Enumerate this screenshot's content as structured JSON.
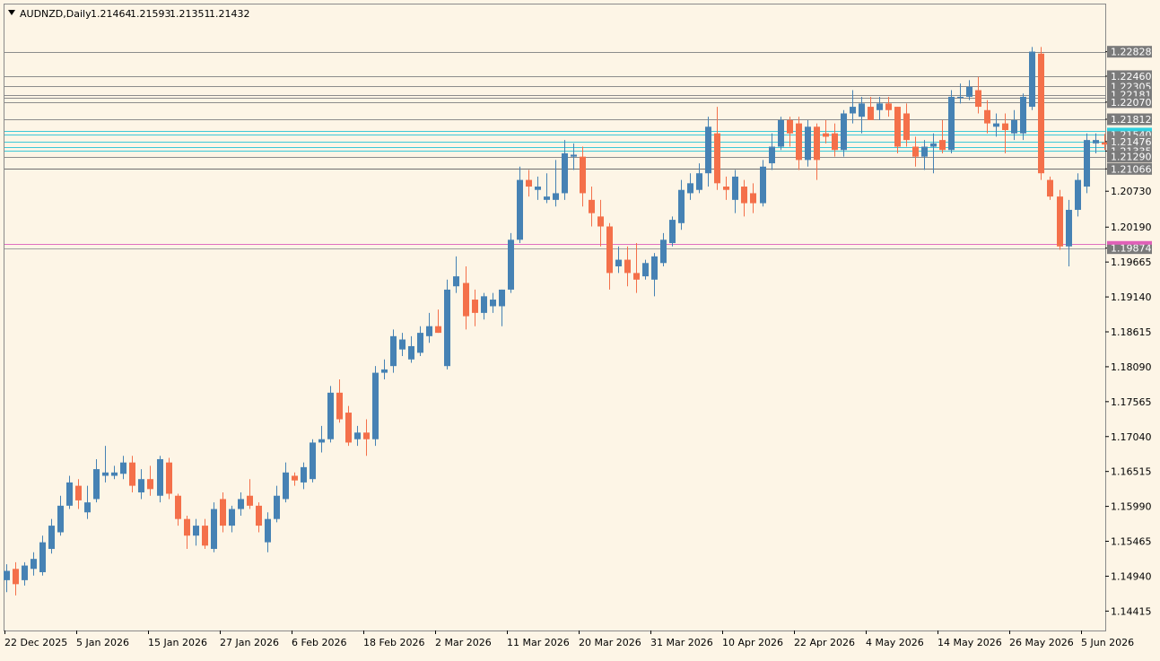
{
  "chart_data": {
    "type": "candlestick",
    "symbol_label": "AUDNZD,Daily",
    "header_ohlc": [
      "1.21464",
      "1.21593",
      "1.21351",
      "1.21432"
    ],
    "ylim": [
      1.1415,
      1.2308
    ],
    "y_ticks": [
      "1.22828",
      "1.22460",
      "1.22070",
      "1.21812",
      "1.21476",
      "1.21335",
      "1.21066",
      "1.20730",
      "1.20190",
      "1.19874",
      "1.19665",
      "1.19140",
      "1.18615",
      "1.18090",
      "1.17565",
      "1.17040",
      "1.16515",
      "1.15990",
      "1.15465",
      "1.14940",
      "1.14415"
    ],
    "x_ticks": [
      "22 Dec 2025",
      "5 Jan 2026",
      "15 Jan 2026",
      "27 Jan 2026",
      "6 Feb 2026",
      "18 Feb 2026",
      "2 Mar 2026",
      "11 Mar 2026",
      "20 Mar 2026",
      "31 Mar 2026",
      "10 Apr 2026",
      "22 Apr 2026",
      "4 May 2026",
      "14 May 2026",
      "26 May 2026",
      "5 Jun 2026"
    ],
    "levels": [
      {
        "value": 1.22828,
        "color": "#8c8c8c",
        "label": "1.22828"
      },
      {
        "value": 1.2246,
        "color": "#8c8c8c",
        "label": "1.22460"
      },
      {
        "value": 1.22305,
        "color": "#8c8c8c",
        "label": "1.22305"
      },
      {
        "value": 1.22181,
        "color": "#8c8c8c",
        "label": "1.22181"
      },
      {
        "value": 1.2214,
        "color": "#8c8c8c",
        "label": ""
      },
      {
        "value": 1.2207,
        "color": "#8c8c8c",
        "label": "1.22070"
      },
      {
        "value": 1.21812,
        "color": "#8c8c8c",
        "label": "1.21812"
      },
      {
        "value": 1.2164,
        "color": "#3cc8d8",
        "label": ""
      },
      {
        "value": 1.2158,
        "color": "#3cc8d8",
        "label": "1.21540"
      },
      {
        "value": 1.21476,
        "color": "#3cc8d8",
        "label": "1.21476"
      },
      {
        "value": 1.214,
        "color": "#3cc8d8",
        "label": ""
      },
      {
        "value": 1.21335,
        "color": "#3cc8d8",
        "label": "1.21335"
      },
      {
        "value": 1.2125,
        "color": "#8c8c8c",
        "label": "1.21290"
      },
      {
        "value": 1.21066,
        "color": "#6e6e6e",
        "label": "1.21066"
      },
      {
        "value": 1.1994,
        "color": "#e070c0",
        "label": ""
      },
      {
        "value": 1.19874,
        "color": "#a0a0a0",
        "label": "1.19874"
      }
    ],
    "current_price": 1.21658,
    "candles": [
      {
        "o": 1.1488,
        "h": 1.1512,
        "l": 1.147,
        "c": 1.1502
      },
      {
        "o": 1.1505,
        "h": 1.1515,
        "l": 1.1465,
        "c": 1.1482
      },
      {
        "o": 1.1488,
        "h": 1.1515,
        "l": 1.148,
        "c": 1.151
      },
      {
        "o": 1.1505,
        "h": 1.153,
        "l": 1.1495,
        "c": 1.152
      },
      {
        "o": 1.15,
        "h": 1.1555,
        "l": 1.1495,
        "c": 1.1545
      },
      {
        "o": 1.1535,
        "h": 1.158,
        "l": 1.1528,
        "c": 1.157
      },
      {
        "o": 1.156,
        "h": 1.1615,
        "l": 1.1555,
        "c": 1.16
      },
      {
        "o": 1.16,
        "h": 1.1645,
        "l": 1.1595,
        "c": 1.1635
      },
      {
        "o": 1.163,
        "h": 1.164,
        "l": 1.1595,
        "c": 1.1608
      },
      {
        "o": 1.159,
        "h": 1.163,
        "l": 1.158,
        "c": 1.1605
      },
      {
        "o": 1.161,
        "h": 1.167,
        "l": 1.1605,
        "c": 1.1655
      },
      {
        "o": 1.1645,
        "h": 1.169,
        "l": 1.1635,
        "c": 1.165
      },
      {
        "o": 1.1645,
        "h": 1.166,
        "l": 1.164,
        "c": 1.165
      },
      {
        "o": 1.1648,
        "h": 1.1675,
        "l": 1.164,
        "c": 1.1665
      },
      {
        "o": 1.1665,
        "h": 1.1675,
        "l": 1.162,
        "c": 1.163
      },
      {
        "o": 1.162,
        "h": 1.1655,
        "l": 1.161,
        "c": 1.164
      },
      {
        "o": 1.164,
        "h": 1.166,
        "l": 1.1615,
        "c": 1.1625
      },
      {
        "o": 1.1615,
        "h": 1.1675,
        "l": 1.1605,
        "c": 1.167
      },
      {
        "o": 1.1665,
        "h": 1.1672,
        "l": 1.161,
        "c": 1.1618
      },
      {
        "o": 1.1615,
        "h": 1.1618,
        "l": 1.157,
        "c": 1.158
      },
      {
        "o": 1.158,
        "h": 1.1585,
        "l": 1.1535,
        "c": 1.1555
      },
      {
        "o": 1.1555,
        "h": 1.158,
        "l": 1.154,
        "c": 1.157
      },
      {
        "o": 1.157,
        "h": 1.158,
        "l": 1.1535,
        "c": 1.154
      },
      {
        "o": 1.1535,
        "h": 1.1605,
        "l": 1.153,
        "c": 1.1595
      },
      {
        "o": 1.161,
        "h": 1.162,
        "l": 1.156,
        "c": 1.157
      },
      {
        "o": 1.157,
        "h": 1.16,
        "l": 1.156,
        "c": 1.1595
      },
      {
        "o": 1.1595,
        "h": 1.162,
        "l": 1.1585,
        "c": 1.161
      },
      {
        "o": 1.1615,
        "h": 1.164,
        "l": 1.1595,
        "c": 1.16
      },
      {
        "o": 1.16,
        "h": 1.1605,
        "l": 1.156,
        "c": 1.157
      },
      {
        "o": 1.1545,
        "h": 1.159,
        "l": 1.153,
        "c": 1.158
      },
      {
        "o": 1.158,
        "h": 1.163,
        "l": 1.1575,
        "c": 1.1615
      },
      {
        "o": 1.161,
        "h": 1.1665,
        "l": 1.1605,
        "c": 1.165
      },
      {
        "o": 1.1645,
        "h": 1.165,
        "l": 1.163,
        "c": 1.1638
      },
      {
        "o": 1.1635,
        "h": 1.1665,
        "l": 1.1625,
        "c": 1.1658
      },
      {
        "o": 1.164,
        "h": 1.17,
        "l": 1.1635,
        "c": 1.1695
      },
      {
        "o": 1.1695,
        "h": 1.172,
        "l": 1.168,
        "c": 1.17
      },
      {
        "o": 1.17,
        "h": 1.178,
        "l": 1.1695,
        "c": 1.177
      },
      {
        "o": 1.177,
        "h": 1.179,
        "l": 1.1725,
        "c": 1.173
      },
      {
        "o": 1.174,
        "h": 1.175,
        "l": 1.169,
        "c": 1.1695
      },
      {
        "o": 1.17,
        "h": 1.172,
        "l": 1.169,
        "c": 1.171
      },
      {
        "o": 1.171,
        "h": 1.173,
        "l": 1.1675,
        "c": 1.17
      },
      {
        "o": 1.17,
        "h": 1.181,
        "l": 1.169,
        "c": 1.18
      },
      {
        "o": 1.18,
        "h": 1.182,
        "l": 1.179,
        "c": 1.1805
      },
      {
        "o": 1.181,
        "h": 1.1865,
        "l": 1.18,
        "c": 1.1855
      },
      {
        "o": 1.1835,
        "h": 1.186,
        "l": 1.1825,
        "c": 1.185
      },
      {
        "o": 1.182,
        "h": 1.1855,
        "l": 1.1815,
        "c": 1.184
      },
      {
        "o": 1.183,
        "h": 1.187,
        "l": 1.1825,
        "c": 1.186
      },
      {
        "o": 1.1855,
        "h": 1.189,
        "l": 1.1845,
        "c": 1.187
      },
      {
        "o": 1.187,
        "h": 1.1895,
        "l": 1.186,
        "c": 1.186
      },
      {
        "o": 1.181,
        "h": 1.194,
        "l": 1.1805,
        "c": 1.1925
      },
      {
        "o": 1.193,
        "h": 1.1975,
        "l": 1.192,
        "c": 1.1945
      },
      {
        "o": 1.1935,
        "h": 1.196,
        "l": 1.1865,
        "c": 1.1885
      },
      {
        "o": 1.191,
        "h": 1.1925,
        "l": 1.187,
        "c": 1.189
      },
      {
        "o": 1.189,
        "h": 1.192,
        "l": 1.188,
        "c": 1.1915
      },
      {
        "o": 1.19,
        "h": 1.192,
        "l": 1.189,
        "c": 1.191
      },
      {
        "o": 1.19,
        "h": 1.1925,
        "l": 1.187,
        "c": 1.1925
      },
      {
        "o": 1.1925,
        "h": 1.201,
        "l": 1.192,
        "c": 1.2
      },
      {
        "o": 1.2,
        "h": 1.211,
        "l": 1.1995,
        "c": 1.209
      },
      {
        "o": 1.209,
        "h": 1.2105,
        "l": 1.2065,
        "c": 1.208
      },
      {
        "o": 1.2075,
        "h": 1.2095,
        "l": 1.206,
        "c": 1.208
      },
      {
        "o": 1.206,
        "h": 1.21,
        "l": 1.2055,
        "c": 1.2065
      },
      {
        "o": 1.206,
        "h": 1.212,
        "l": 1.205,
        "c": 1.207
      },
      {
        "o": 1.207,
        "h": 1.215,
        "l": 1.206,
        "c": 1.213
      },
      {
        "o": 1.2125,
        "h": 1.2145,
        "l": 1.2105,
        "c": 1.2128
      },
      {
        "o": 1.2125,
        "h": 1.214,
        "l": 1.205,
        "c": 1.207
      },
      {
        "o": 1.206,
        "h": 1.208,
        "l": 1.202,
        "c": 1.204
      },
      {
        "o": 1.2035,
        "h": 1.206,
        "l": 1.199,
        "c": 1.202
      },
      {
        "o": 1.202,
        "h": 1.2025,
        "l": 1.1925,
        "c": 1.195
      },
      {
        "o": 1.196,
        "h": 1.199,
        "l": 1.195,
        "c": 1.197
      },
      {
        "o": 1.197,
        "h": 1.199,
        "l": 1.193,
        "c": 1.195
      },
      {
        "o": 1.195,
        "h": 1.1995,
        "l": 1.192,
        "c": 1.194
      },
      {
        "o": 1.1945,
        "h": 1.197,
        "l": 1.194,
        "c": 1.1965
      },
      {
        "o": 1.194,
        "h": 1.198,
        "l": 1.1915,
        "c": 1.1975
      },
      {
        "o": 1.1965,
        "h": 1.201,
        "l": 1.196,
        "c": 1.2
      },
      {
        "o": 1.1995,
        "h": 1.2035,
        "l": 1.199,
        "c": 1.203
      },
      {
        "o": 1.2025,
        "h": 1.209,
        "l": 1.2015,
        "c": 1.2075
      },
      {
        "o": 1.207,
        "h": 1.21,
        "l": 1.206,
        "c": 1.2085
      },
      {
        "o": 1.2075,
        "h": 1.2115,
        "l": 1.207,
        "c": 1.21
      },
      {
        "o": 1.21,
        "h": 1.2185,
        "l": 1.208,
        "c": 1.217
      },
      {
        "o": 1.216,
        "h": 1.22,
        "l": 1.2075,
        "c": 1.2085
      },
      {
        "o": 1.208,
        "h": 1.2095,
        "l": 1.206,
        "c": 1.2075
      },
      {
        "o": 1.206,
        "h": 1.2105,
        "l": 1.204,
        "c": 1.2095
      },
      {
        "o": 1.208,
        "h": 1.209,
        "l": 1.2035,
        "c": 1.2055
      },
      {
        "o": 1.207,
        "h": 1.2085,
        "l": 1.204,
        "c": 1.2055
      },
      {
        "o": 1.2055,
        "h": 1.212,
        "l": 1.205,
        "c": 1.211
      },
      {
        "o": 1.2115,
        "h": 1.216,
        "l": 1.2105,
        "c": 1.214
      },
      {
        "o": 1.214,
        "h": 1.2185,
        "l": 1.2135,
        "c": 1.218
      },
      {
        "o": 1.218,
        "h": 1.2185,
        "l": 1.214,
        "c": 1.216
      },
      {
        "o": 1.2175,
        "h": 1.2185,
        "l": 1.2105,
        "c": 1.212
      },
      {
        "o": 1.212,
        "h": 1.218,
        "l": 1.211,
        "c": 1.217
      },
      {
        "o": 1.217,
        "h": 1.2175,
        "l": 1.209,
        "c": 1.212
      },
      {
        "o": 1.216,
        "h": 1.218,
        "l": 1.2145,
        "c": 1.2155
      },
      {
        "o": 1.216,
        "h": 1.2175,
        "l": 1.2125,
        "c": 1.2135
      },
      {
        "o": 1.2135,
        "h": 1.2195,
        "l": 1.2125,
        "c": 1.219
      },
      {
        "o": 1.219,
        "h": 1.2225,
        "l": 1.2175,
        "c": 1.22
      },
      {
        "o": 1.2185,
        "h": 1.2215,
        "l": 1.216,
        "c": 1.2205
      },
      {
        "o": 1.22,
        "h": 1.2215,
        "l": 1.218,
        "c": 1.218
      },
      {
        "o": 1.2195,
        "h": 1.2215,
        "l": 1.218,
        "c": 1.2205
      },
      {
        "o": 1.2205,
        "h": 1.2215,
        "l": 1.2185,
        "c": 1.2195
      },
      {
        "o": 1.22,
        "h": 1.22,
        "l": 1.213,
        "c": 1.214
      },
      {
        "o": 1.219,
        "h": 1.2205,
        "l": 1.214,
        "c": 1.215
      },
      {
        "o": 1.214,
        "h": 1.2155,
        "l": 1.211,
        "c": 1.2125
      },
      {
        "o": 1.2125,
        "h": 1.215,
        "l": 1.2105,
        "c": 1.214
      },
      {
        "o": 1.214,
        "h": 1.216,
        "l": 1.21,
        "c": 1.2145
      },
      {
        "o": 1.215,
        "h": 1.218,
        "l": 1.213,
        "c": 1.2135
      },
      {
        "o": 1.2135,
        "h": 1.2225,
        "l": 1.213,
        "c": 1.2215
      },
      {
        "o": 1.2215,
        "h": 1.2235,
        "l": 1.2205,
        "c": 1.2215
      },
      {
        "o": 1.2215,
        "h": 1.224,
        "l": 1.221,
        "c": 1.223
      },
      {
        "o": 1.2225,
        "h": 1.2245,
        "l": 1.219,
        "c": 1.22
      },
      {
        "o": 1.2195,
        "h": 1.221,
        "l": 1.216,
        "c": 1.2175
      },
      {
        "o": 1.217,
        "h": 1.219,
        "l": 1.2155,
        "c": 1.2175
      },
      {
        "o": 1.2175,
        "h": 1.219,
        "l": 1.213,
        "c": 1.2165
      },
      {
        "o": 1.216,
        "h": 1.2195,
        "l": 1.215,
        "c": 1.218
      },
      {
        "o": 1.216,
        "h": 1.222,
        "l": 1.215,
        "c": 1.2215
      },
      {
        "o": 1.22,
        "h": 1.229,
        "l": 1.2195,
        "c": 1.2283
      },
      {
        "o": 1.228,
        "h": 1.229,
        "l": 1.209,
        "c": 1.21
      },
      {
        "o": 1.209,
        "h": 1.2095,
        "l": 1.206,
        "c": 1.2065
      },
      {
        "o": 1.2065,
        "h": 1.2075,
        "l": 1.1985,
        "c": 1.199
      },
      {
        "o": 1.199,
        "h": 1.206,
        "l": 1.196,
        "c": 1.2045
      },
      {
        "o": 1.2045,
        "h": 1.21,
        "l": 1.2035,
        "c": 1.209
      },
      {
        "o": 1.208,
        "h": 1.216,
        "l": 1.207,
        "c": 1.215
      },
      {
        "o": 1.2145,
        "h": 1.216,
        "l": 1.213,
        "c": 1.215
      },
      {
        "o": 1.21464,
        "h": 1.21593,
        "l": 1.21351,
        "c": 1.21432
      }
    ]
  }
}
